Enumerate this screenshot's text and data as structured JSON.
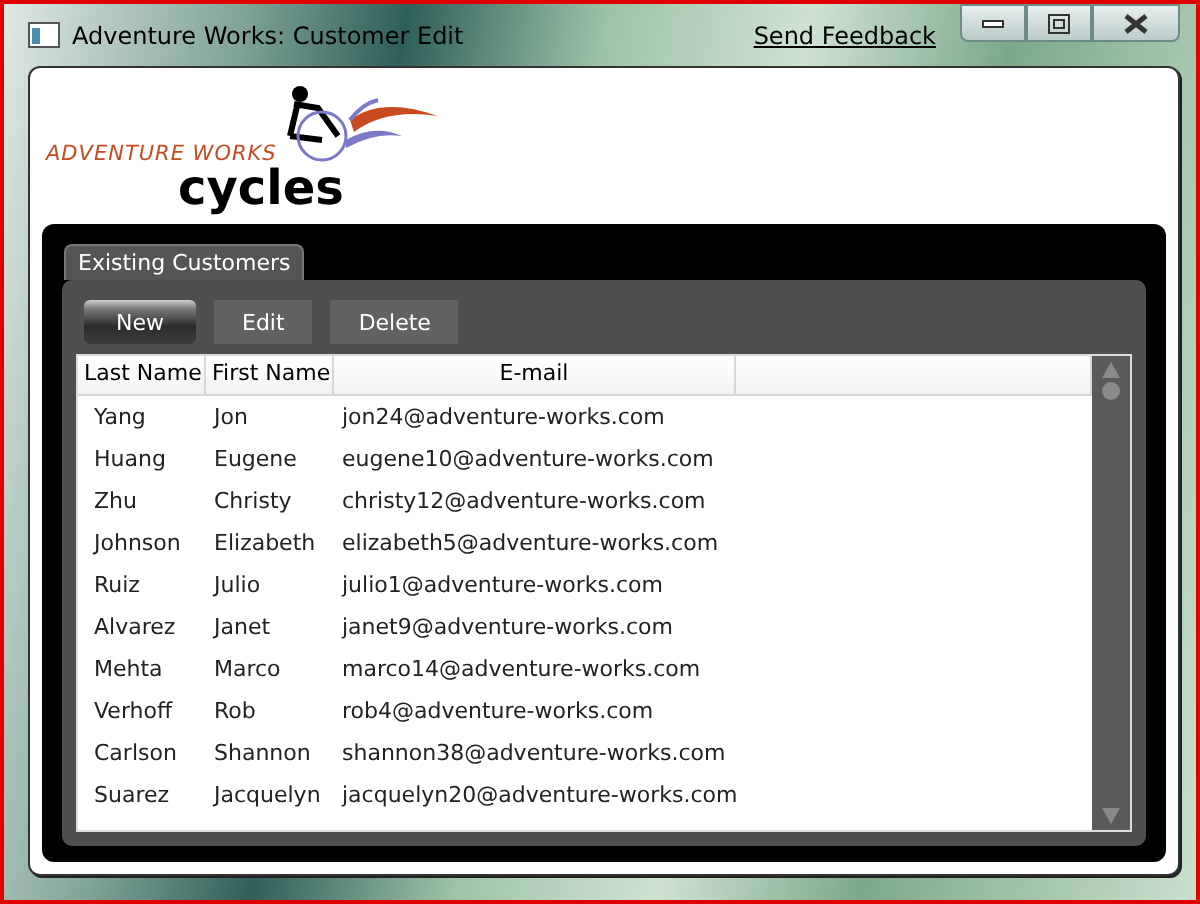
{
  "window": {
    "title": "Adventure Works: Customer Edit",
    "feedback_link": "Send Feedback"
  },
  "logo": {
    "brand": "ADVENTURE WORKS",
    "word": "cycles"
  },
  "tab": {
    "label": "Existing Customers"
  },
  "toolbar": [
    {
      "label": "New",
      "kind": "default"
    },
    {
      "label": "Edit",
      "kind": "normal"
    },
    {
      "label": "Delete",
      "kind": "normal"
    }
  ],
  "table": {
    "columns": [
      "Last Name",
      "First Name",
      "E-mail"
    ],
    "rows": [
      [
        "Yang",
        "Jon",
        "jon24@adventure-works.com"
      ],
      [
        "Huang",
        "Eugene",
        "eugene10@adventure-works.com"
      ],
      [
        "Zhu",
        "Christy",
        "christy12@adventure-works.com"
      ],
      [
        "Johnson",
        "Elizabeth",
        "elizabeth5@adventure-works.com"
      ],
      [
        "Ruiz",
        "Julio",
        "julio1@adventure-works.com"
      ],
      [
        "Alvarez",
        "Janet",
        "janet9@adventure-works.com"
      ],
      [
        "Mehta",
        "Marco",
        "marco14@adventure-works.com"
      ],
      [
        "Verhoff",
        "Rob",
        "rob4@adventure-works.com"
      ],
      [
        "Carlson",
        "Shannon",
        "shannon38@adventure-works.com"
      ],
      [
        "Suarez",
        "Jacquelyn",
        "jacquelyn20@adventure-works.com"
      ]
    ]
  }
}
